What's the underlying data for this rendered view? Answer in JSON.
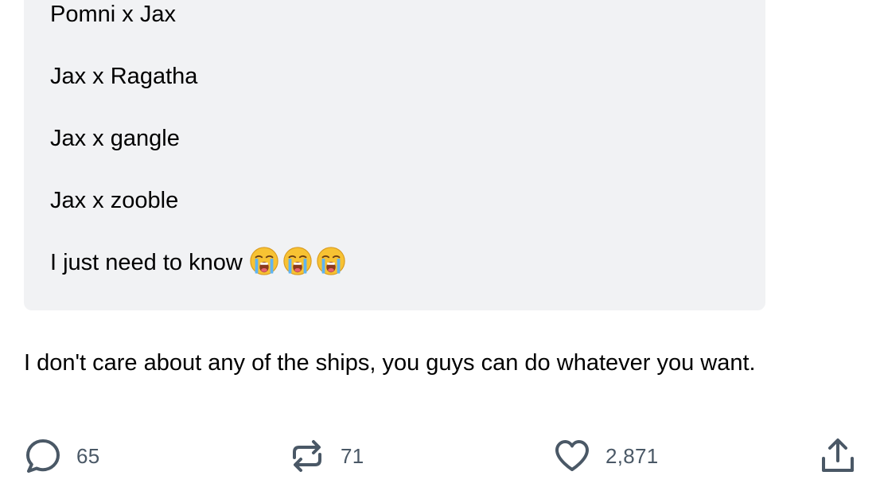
{
  "quote": {
    "lines": [
      "Pomni x Jax",
      "Jax x Ragatha",
      "Jax x gangle",
      "Jax x zooble",
      "I just need to know"
    ],
    "emoji": "loudly-crying-face-emoji",
    "emoji_count": 3
  },
  "reply": {
    "text": "I don't care about any of the ships, you guys can do whatever you want."
  },
  "actions": {
    "comments_count": "65",
    "reblogs_count": "71",
    "likes_count": "2,871",
    "icon_color": "#4a5866"
  }
}
